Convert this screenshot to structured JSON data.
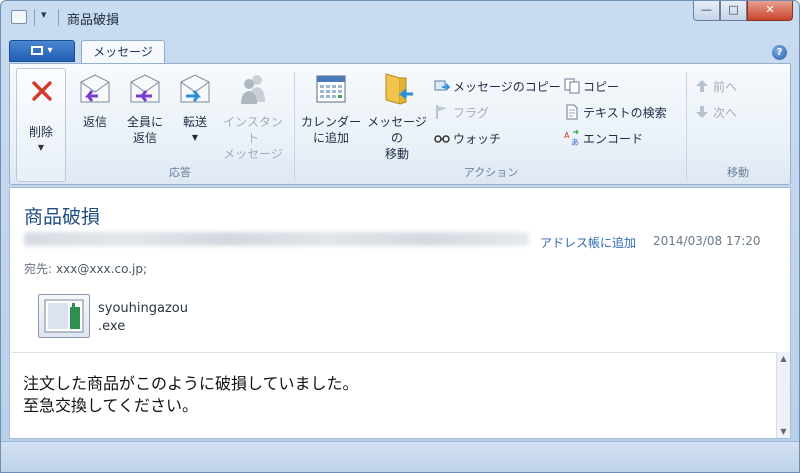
{
  "window": {
    "title": "商品破損",
    "controls": {
      "minimize": "—",
      "maximize": "□",
      "close": "✕"
    }
  },
  "tabs": [
    {
      "label": "メッセージ",
      "active": true
    }
  ],
  "ribbon": {
    "delete": {
      "label": "削除"
    },
    "respond": {
      "group_label": "応答",
      "reply": "返信",
      "reply_all_1": "全員に",
      "reply_all_2": "返信",
      "forward": "転送",
      "instant_1": "インスタント",
      "instant_2": "メッセージ"
    },
    "actions": {
      "group_label": "アクション",
      "calendar_1": "カレンダー",
      "calendar_2": "に追加",
      "move_1": "メッセージの",
      "move_2": "移動",
      "copy_message": "メッセージのコピー",
      "flag": "フラグ",
      "watch": "ウォッチ",
      "copy": "コピー",
      "find_text": "テキストの検索",
      "encode": "エンコード"
    },
    "move": {
      "group_label": "移動",
      "prev": "前へ",
      "next": "次へ"
    }
  },
  "message": {
    "subject": "商品破損",
    "add_to_contacts": "アドレス帳に追加",
    "timestamp": "2014/03/08 17:20",
    "to_label": "宛先:",
    "to_value": "xxx@xxx.co.jp;",
    "attachment": {
      "name_line1": "syouhingazou",
      "name_line2": ".exe"
    },
    "body_line1": "注文した商品がこのように破損していました。",
    "body_line2": "至急交換してください。"
  },
  "colors": {
    "accent": "#1f5eb3",
    "subject": "#1f4f82",
    "link": "#2d67b3",
    "close_button": "#c8452d"
  }
}
